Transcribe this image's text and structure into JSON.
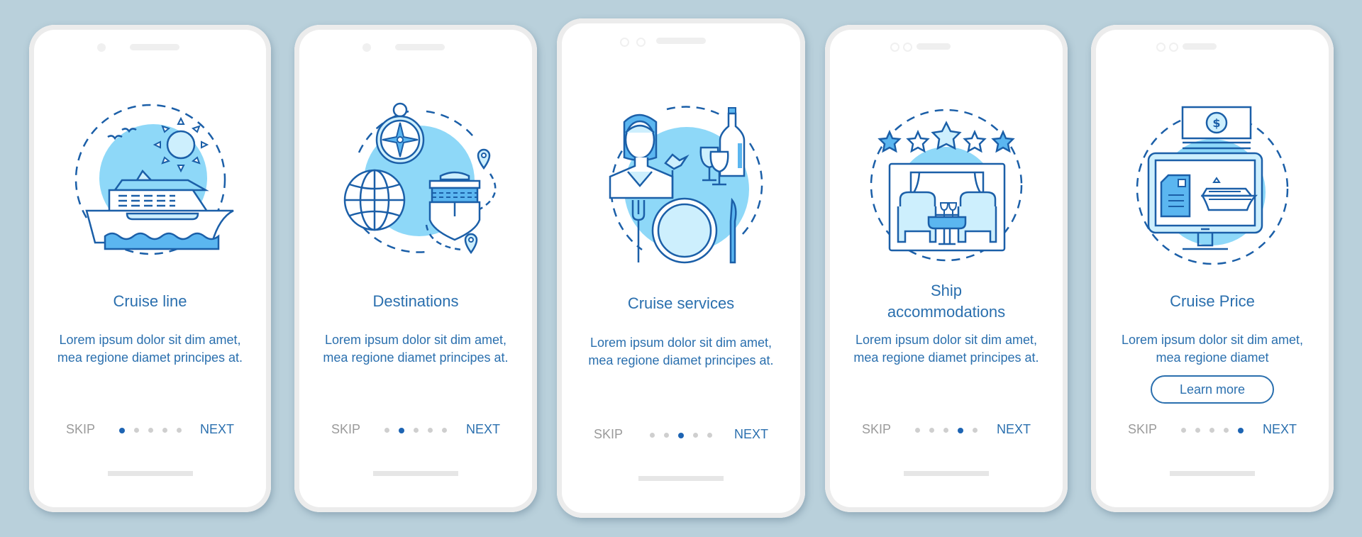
{
  "colors": {
    "background": "#b9d0db",
    "primary_text": "#2a6fae",
    "skip_text": "#9a9a9a",
    "dot_active": "#1d64b3",
    "dot_inactive": "#cfcfcf",
    "illustration_fill": "#8ed8f8",
    "illustration_stroke": "#1b5fa8"
  },
  "screens": [
    {
      "illustration": "cruise-ship-icon",
      "title": "Cruise line",
      "body": "Lorem ipsum dolor sit dim amet, mea regione diamet principes at.",
      "skip_label": "SKIP",
      "next_label": "NEXT",
      "page_index": 1,
      "page_count": 5
    },
    {
      "illustration": "destinations-icon",
      "title": "Destinations",
      "body": "Lorem ipsum dolor sit dim amet, mea regione diamet principes at.",
      "skip_label": "SKIP",
      "next_label": "NEXT",
      "page_index": 2,
      "page_count": 5
    },
    {
      "illustration": "cruise-services-icon",
      "title": "Cruise services",
      "body": "Lorem ipsum dolor sit dim amet, mea regione diamet principes at.",
      "skip_label": "SKIP",
      "next_label": "NEXT",
      "page_index": 3,
      "page_count": 5
    },
    {
      "illustration": "ship-accommodations-icon",
      "title": "Ship accommodations",
      "body": "Lorem ipsum dolor sit dim amet, mea regione diamet principes at.",
      "skip_label": "SKIP",
      "next_label": "NEXT",
      "page_index": 4,
      "page_count": 5
    },
    {
      "illustration": "cruise-price-icon",
      "title": "Cruise Price",
      "body": "Lorem ipsum dolor sit dim amet, mea regione diamet",
      "button_label": "Learn more",
      "skip_label": "SKIP",
      "next_label": "NEXT",
      "page_index": 5,
      "page_count": 5
    }
  ]
}
